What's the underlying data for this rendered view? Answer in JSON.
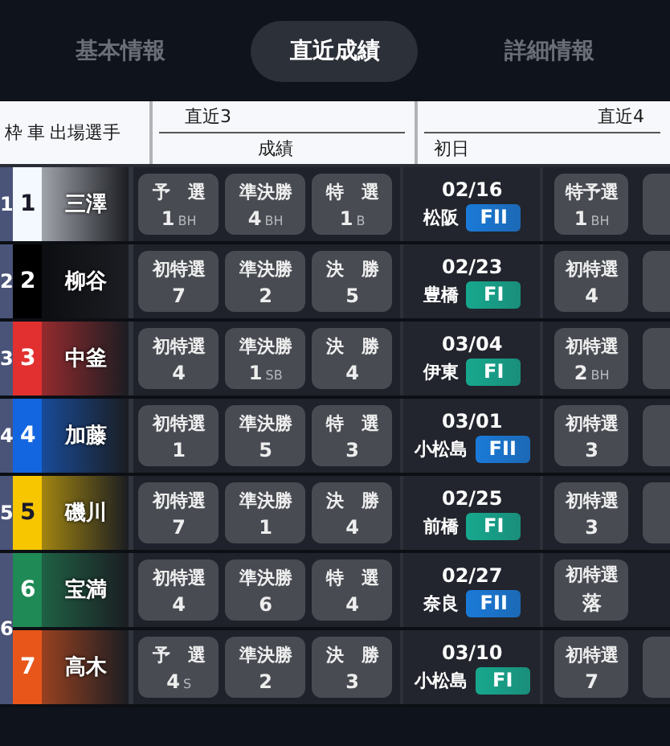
{
  "tabs": [
    {
      "label": "基本情報",
      "selected": false
    },
    {
      "label": "直近成績",
      "selected": true
    },
    {
      "label": "詳細情報",
      "selected": false
    }
  ],
  "header": {
    "frame": "枠",
    "car": "車",
    "rider": "出場選手",
    "recent3": "直近3",
    "results": "成績",
    "recent4": "直近4",
    "first_day": "初日"
  },
  "frames": [
    {
      "number": "1",
      "riders": [
        {
          "car": "1",
          "color": "#f4f8ff",
          "name": "三澤",
          "results": [
            {
              "label": "予　選",
              "value": "1",
              "suffix": "BH"
            },
            {
              "label": "準決勝",
              "value": "4",
              "suffix": "BH"
            },
            {
              "label": "特　選",
              "value": "1",
              "suffix": "B"
            }
          ],
          "date": "02/16",
          "venue": "松阪",
          "grade": {
            "text": "FII",
            "color": "#1a7ad8"
          },
          "first": {
            "label": "特予選",
            "value": "1",
            "suffix": "BH"
          },
          "more_results": true
        }
      ]
    },
    {
      "number": "2",
      "riders": [
        {
          "car": "2",
          "color": "#000000",
          "name": "柳谷",
          "results": [
            {
              "label": "初特選",
              "value": "7"
            },
            {
              "label": "準決勝",
              "value": "2"
            },
            {
              "label": "決　勝",
              "value": "5"
            }
          ],
          "date": "02/23",
          "venue": "豊橋",
          "grade": {
            "text": "FI",
            "color": "#17a88e"
          },
          "first": {
            "label": "初特選",
            "value": "4"
          },
          "more_results": true
        }
      ]
    },
    {
      "number": "3",
      "riders": [
        {
          "car": "3",
          "color": "#e23030",
          "name": "中釜",
          "results": [
            {
              "label": "初特選",
              "value": "4"
            },
            {
              "label": "準決勝",
              "value": "1",
              "suffix": "SB"
            },
            {
              "label": "決　勝",
              "value": "4"
            }
          ],
          "date": "03/04",
          "venue": "伊東",
          "grade": {
            "text": "FI",
            "color": "#17a88e"
          },
          "first": {
            "label": "初特選",
            "value": "2",
            "suffix": "BH"
          },
          "more_results": true
        }
      ]
    },
    {
      "number": "4",
      "riders": [
        {
          "car": "4",
          "color": "#1466e0",
          "name": "加藤",
          "results": [
            {
              "label": "初特選",
              "value": "1"
            },
            {
              "label": "準決勝",
              "value": "5"
            },
            {
              "label": "特　選",
              "value": "3"
            }
          ],
          "date": "03/01",
          "venue": "小松島",
          "grade": {
            "text": "FII",
            "color": "#1a7ad8"
          },
          "first": {
            "label": "初特選",
            "value": "3"
          },
          "more_results": true
        }
      ]
    },
    {
      "number": "5",
      "riders": [
        {
          "car": "5",
          "color": "#f7c600",
          "name": "磯川",
          "results": [
            {
              "label": "初特選",
              "value": "7"
            },
            {
              "label": "準決勝",
              "value": "1"
            },
            {
              "label": "決　勝",
              "value": "4"
            }
          ],
          "date": "02/25",
          "venue": "前橋",
          "grade": {
            "text": "FI",
            "color": "#17a88e"
          },
          "first": {
            "label": "初特選",
            "value": "3"
          },
          "more_results": true
        }
      ]
    },
    {
      "number": "6",
      "riders": [
        {
          "car": "6",
          "color": "#1f8a55",
          "name": "宝満",
          "results": [
            {
              "label": "初特選",
              "value": "4"
            },
            {
              "label": "準決勝",
              "value": "6"
            },
            {
              "label": "特　選",
              "value": "4"
            }
          ],
          "date": "02/27",
          "venue": "奈良",
          "grade": {
            "text": "FII",
            "color": "#1a7ad8"
          },
          "first": {
            "label": "初特選",
            "value": "落"
          },
          "more_results": false
        },
        {
          "car": "7",
          "color": "#e8561a",
          "name": "高木",
          "results": [
            {
              "label": "予　選",
              "value": "4",
              "suffix": "S"
            },
            {
              "label": "準決勝",
              "value": "2"
            },
            {
              "label": "決　勝",
              "value": "3"
            }
          ],
          "date": "03/10",
          "venue": "小松島",
          "grade": {
            "text": "FI",
            "color": "#17a88e"
          },
          "first": {
            "label": "初特選",
            "value": "7"
          },
          "more_results": true
        }
      ]
    }
  ]
}
